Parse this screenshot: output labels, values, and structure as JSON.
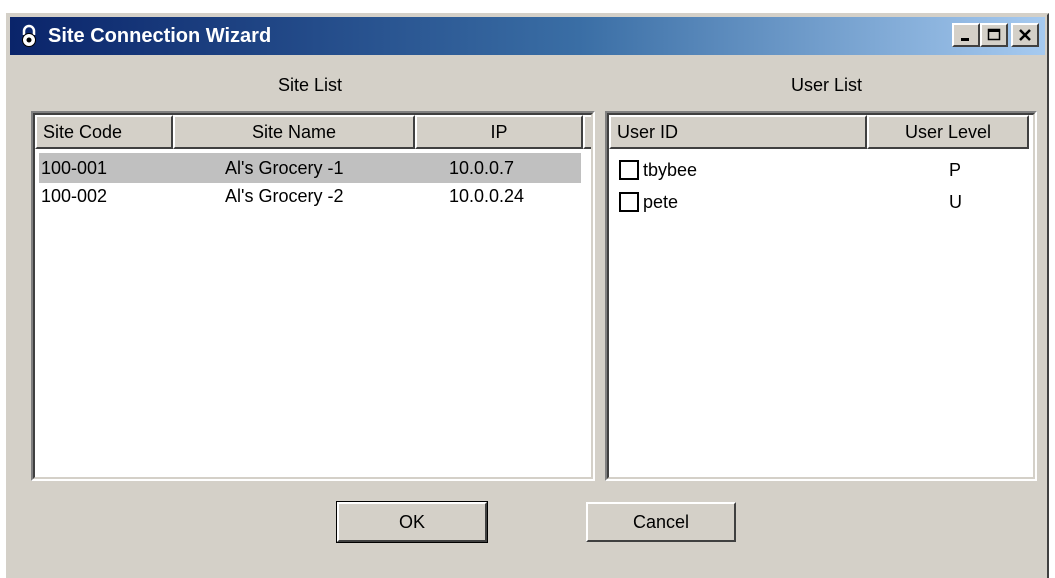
{
  "window": {
    "title": "Site Connection Wizard",
    "icon": "lock-icon",
    "controls": {
      "minimize": "minimize-icon",
      "maximize": "maximize-icon",
      "close": "close-icon"
    }
  },
  "site_list": {
    "title": "Site List",
    "columns": [
      "Site Code",
      "Site Name",
      "IP"
    ],
    "rows": [
      {
        "code": "100-001",
        "name": "Al's Grocery -1",
        "ip": "10.0.0.7",
        "selected": true
      },
      {
        "code": "100-002",
        "name": "Al's Grocery -2",
        "ip": "10.0.0.24",
        "selected": false
      }
    ]
  },
  "user_list": {
    "title": "User List",
    "columns": [
      "User ID",
      "User Level"
    ],
    "rows": [
      {
        "user_id": "tbybee",
        "level": "P",
        "checked": false
      },
      {
        "user_id": "pete",
        "level": "U",
        "checked": false
      }
    ]
  },
  "buttons": {
    "ok": "OK",
    "cancel": "Cancel"
  },
  "colors": {
    "titlebar_start": "#0a246a",
    "titlebar_end": "#a6caf0",
    "face": "#d4d0c8",
    "selection": "#c0c0c0"
  }
}
